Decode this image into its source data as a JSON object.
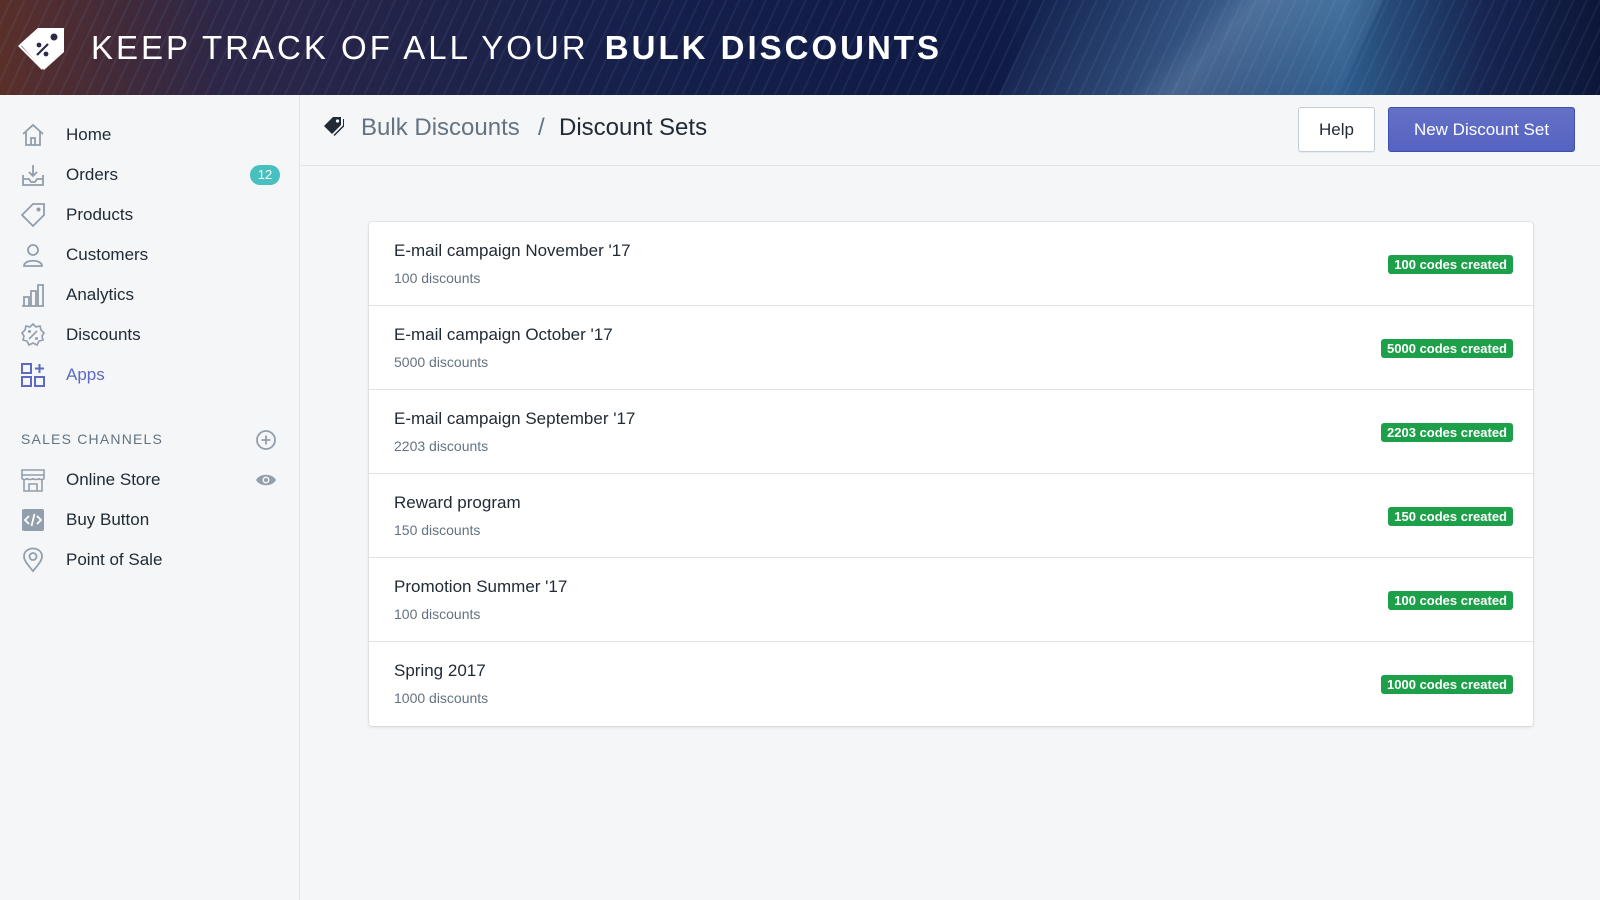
{
  "banner": {
    "title_light": "KEEP TRACK OF ALL YOUR",
    "title_bold": "BULK DISCOUNTS",
    "logo_icon": "discount-tag-icon"
  },
  "sidebar": {
    "items": [
      {
        "label": "Home",
        "icon": "home-icon"
      },
      {
        "label": "Orders",
        "icon": "orders-icon",
        "badge": "12"
      },
      {
        "label": "Products",
        "icon": "tag-icon"
      },
      {
        "label": "Customers",
        "icon": "person-icon"
      },
      {
        "label": "Analytics",
        "icon": "bar-chart-icon"
      },
      {
        "label": "Discounts",
        "icon": "discount-icon"
      },
      {
        "label": "Apps",
        "icon": "apps-icon",
        "active": true
      }
    ],
    "sales_channels_title": "SALES CHANNELS",
    "channels": [
      {
        "label": "Online Store",
        "icon": "store-icon"
      },
      {
        "label": "Buy Button",
        "icon": "code-icon"
      },
      {
        "label": "Point of Sale",
        "icon": "location-pin-icon"
      }
    ]
  },
  "breadcrumb": {
    "parent": "Bulk Discounts",
    "separator": "/",
    "current": "Discount Sets"
  },
  "actions": {
    "help_label": "Help",
    "new_label": "New Discount Set"
  },
  "discount_sets": [
    {
      "title": "E-mail campaign November '17",
      "subtitle": "100 discounts",
      "badge": "100 codes created"
    },
    {
      "title": "E-mail campaign October '17",
      "subtitle": "5000 discounts",
      "badge": "5000 codes created"
    },
    {
      "title": "E-mail campaign September '17",
      "subtitle": "2203 discounts",
      "badge": "2203 codes created"
    },
    {
      "title": "Reward program",
      "subtitle": "150 discounts",
      "badge": "150 codes created"
    },
    {
      "title": "Promotion Summer '17",
      "subtitle": "100 discounts",
      "badge": "100 codes created"
    },
    {
      "title": "Spring 2017",
      "subtitle": "1000 discounts",
      "badge": "1000 codes created"
    }
  ],
  "colors": {
    "accent": "#5c6ac4",
    "badge_green": "#1ea04a",
    "count_badge": "#47c1bf"
  }
}
